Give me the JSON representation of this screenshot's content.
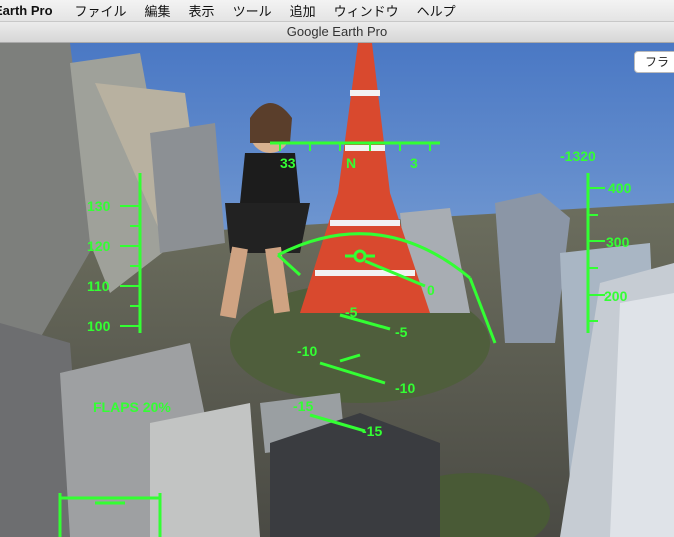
{
  "menubar": {
    "app_name": "Earth Pro",
    "items": [
      "ファイル",
      "編集",
      "表示",
      "ツール",
      "追加",
      "ウィンドウ",
      "ヘルプ"
    ]
  },
  "window": {
    "title": "Google Earth Pro"
  },
  "search": {
    "fly_to_label": "フラ"
  },
  "hud": {
    "color": "#33ff33",
    "heading": {
      "left": "33",
      "center": "N",
      "right": "3"
    },
    "speed_ticks": [
      "130",
      "120",
      "110",
      "100"
    ],
    "altitude_ticks": [
      "400",
      "300",
      "200"
    ],
    "vertical_speed": "-1320",
    "pitch_ladder": [
      {
        "left": "",
        "right": "0"
      },
      {
        "left": "-5",
        "right": "-5"
      },
      {
        "left": "-10",
        "right": "-10"
      },
      {
        "left": "-15",
        "right": "-15"
      }
    ],
    "flaps": "FLAPS 20%"
  }
}
